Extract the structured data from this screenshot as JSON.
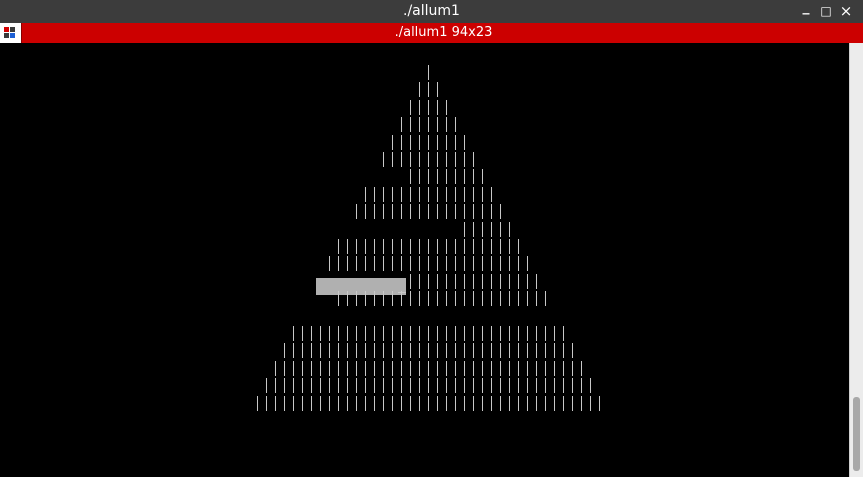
{
  "window": {
    "title": "./allum1"
  },
  "window_controls": {
    "minimize": "_",
    "maximize": "□",
    "close": "×"
  },
  "tab": {
    "title": "./allum1 94x23"
  },
  "terminal": {
    "cursor_char": "_",
    "rows": [
      {
        "start": 428,
        "count": 1
      },
      {
        "start": 419,
        "count": 3
      },
      {
        "start": 410,
        "count": 5
      },
      {
        "start": 401,
        "count": 7
      },
      {
        "start": 392,
        "count": 9
      },
      {
        "start": 383,
        "count": 11
      },
      {
        "start": 410,
        "count": 9
      },
      {
        "start": 365,
        "count": 15
      },
      {
        "start": 356,
        "count": 17
      },
      {
        "start": 464,
        "count": 6
      },
      {
        "start": 338,
        "count": 21
      },
      {
        "start": 329,
        "count": 23
      },
      {
        "start": 410,
        "count": 15
      },
      {
        "start": 338,
        "count": 24
      },
      {
        "start": null,
        "count": 0
      },
      {
        "start": 293,
        "count": 31
      },
      {
        "start": 284,
        "count": 33
      },
      {
        "start": 275,
        "count": 35
      },
      {
        "start": 266,
        "count": 37
      },
      {
        "start": 257,
        "count": 39
      }
    ]
  },
  "colors": {
    "titlebar": "#3c3c3c",
    "tabbar": "#cc0000",
    "terminal_bg": "#000000",
    "terminal_fg": "#c8c8c8",
    "selection": "#b0b0b0"
  }
}
